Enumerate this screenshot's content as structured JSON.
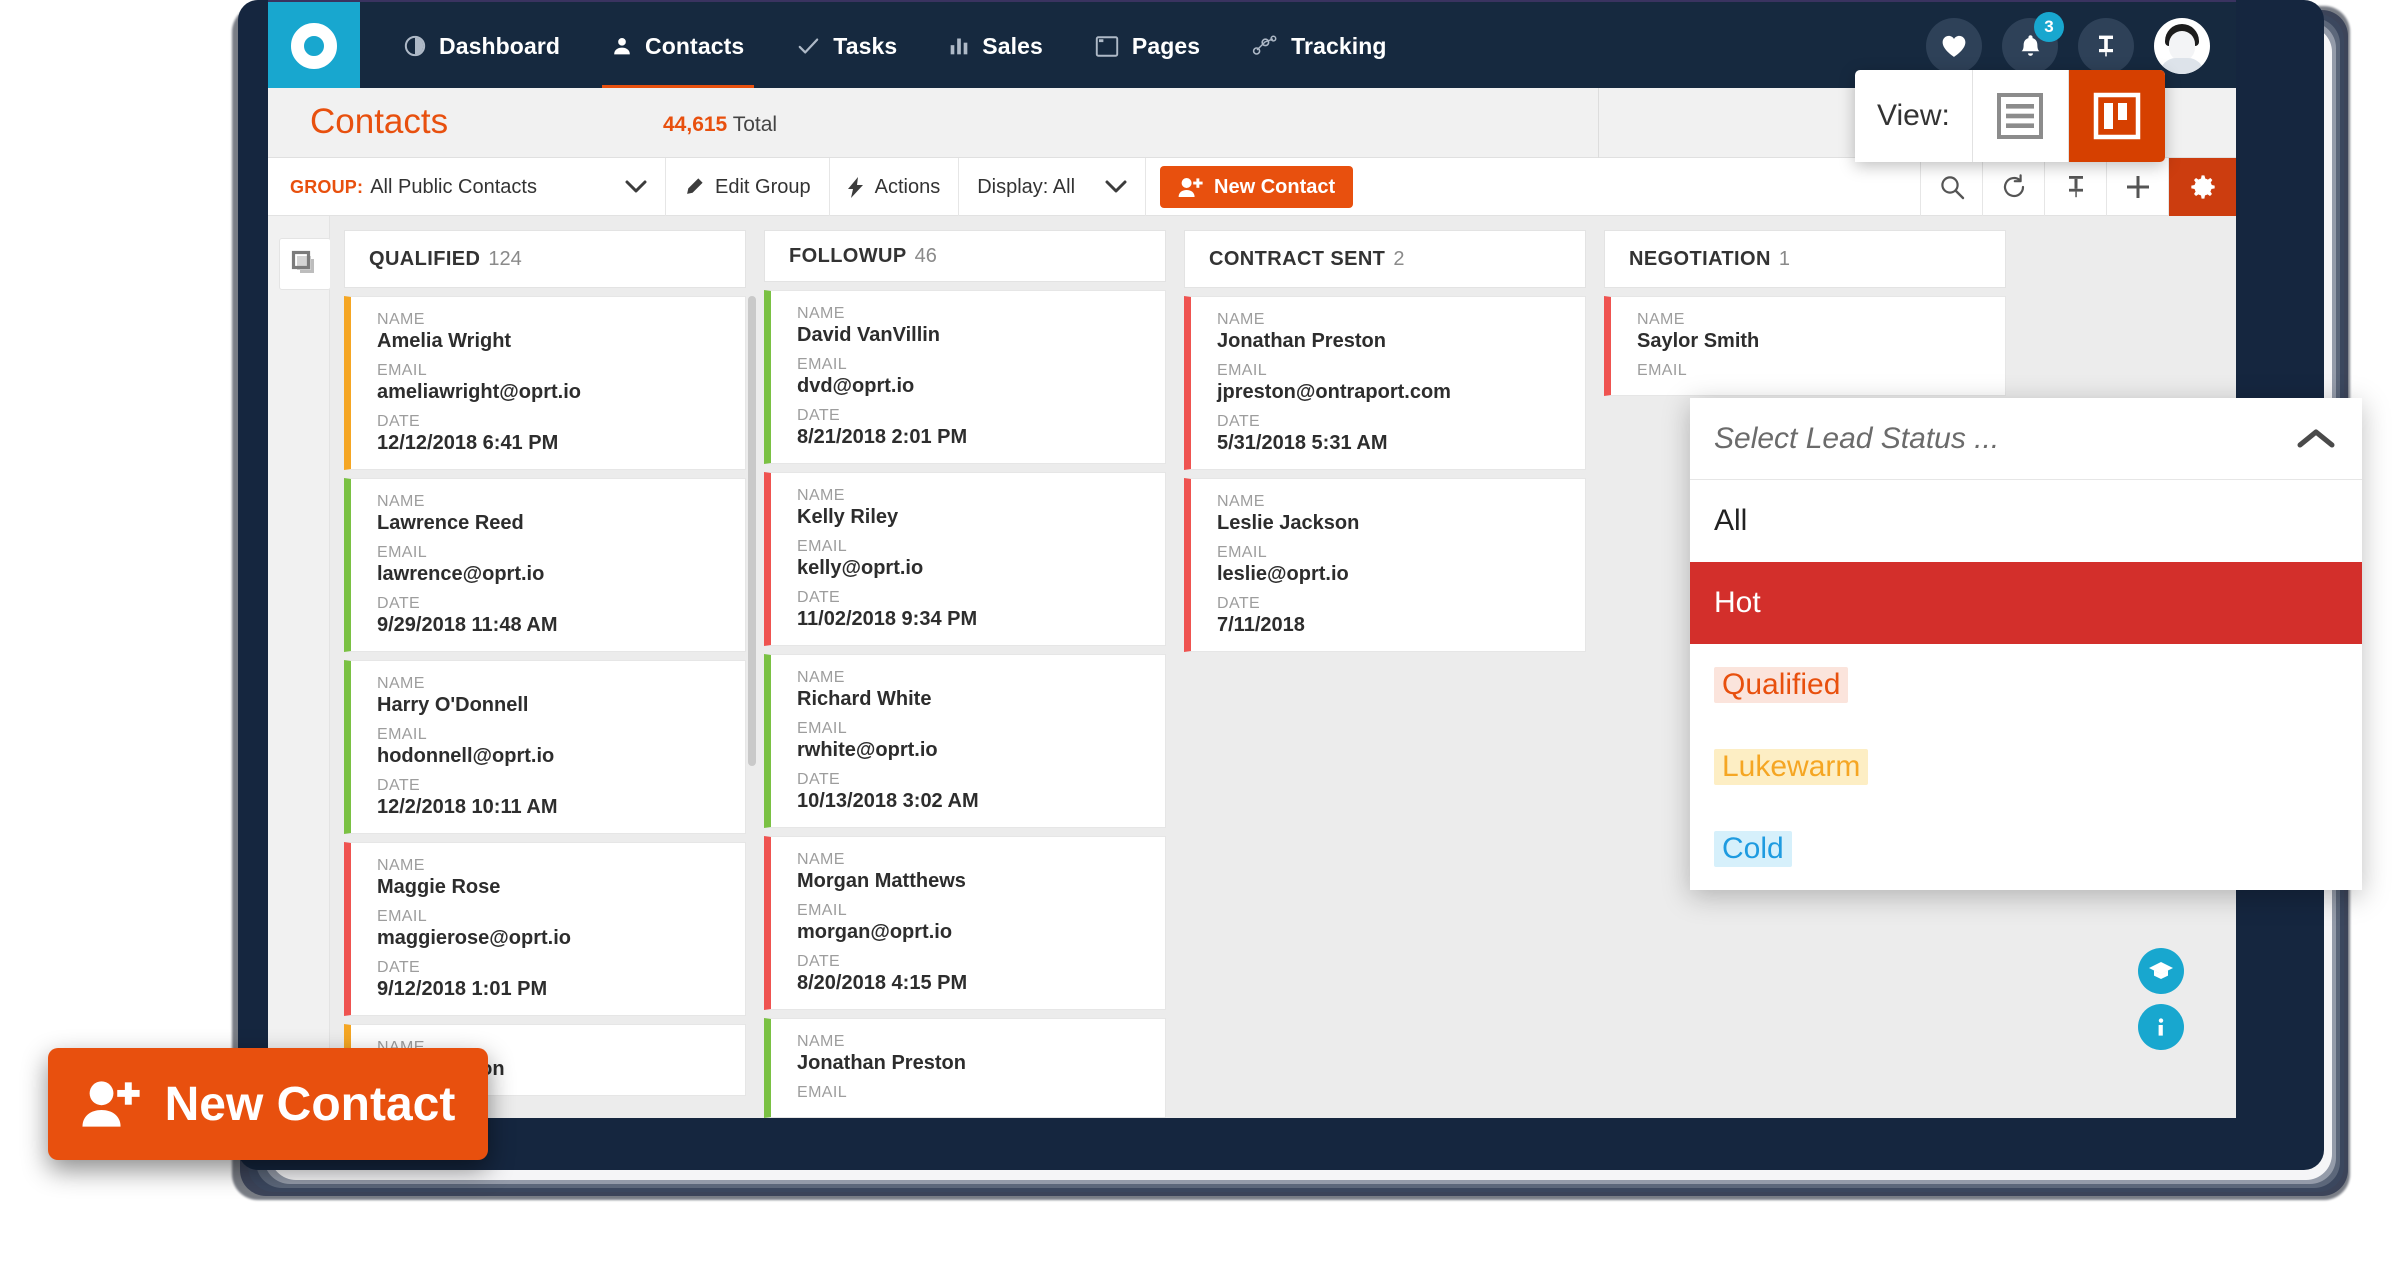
{
  "colors": {
    "brand_orange": "#e8500e",
    "nav_dark": "#16293f",
    "logo_blue": "#18a7cf",
    "hot_red": "#d32f2b",
    "qualified_orange": "#e8500e",
    "lukewarm_yellow": "#f5a623",
    "cold_blue": "#1e9be0"
  },
  "topnav": {
    "logo_name": "ontraport-logo",
    "items": [
      {
        "label": "Dashboard",
        "icon": "dashboard-icon",
        "active": false
      },
      {
        "label": "Contacts",
        "icon": "person-icon",
        "active": true
      },
      {
        "label": "Tasks",
        "icon": "check-icon",
        "active": false
      },
      {
        "label": "Sales",
        "icon": "bar-chart-icon",
        "active": false
      },
      {
        "label": "Pages",
        "icon": "window-icon",
        "active": false
      },
      {
        "label": "Tracking",
        "icon": "nodes-icon",
        "active": false
      }
    ],
    "right_icons": [
      {
        "name": "heart-icon",
        "badge": ""
      },
      {
        "name": "bell-icon",
        "badge": "3"
      },
      {
        "name": "pin-icon",
        "badge": ""
      },
      {
        "name": "avatar",
        "badge": ""
      }
    ]
  },
  "page": {
    "title": "Contacts",
    "total_value": "44,615",
    "total_label": "Total"
  },
  "toolbar": {
    "group_key": "GROUP:",
    "group_value": "All Public Contacts",
    "edit_group_label": "Edit Group",
    "actions_label": "Actions",
    "display_label": "Display: All",
    "new_contact_label": "New Contact",
    "icons": [
      {
        "name": "search-icon"
      },
      {
        "name": "refresh-icon"
      },
      {
        "name": "pin-icon"
      },
      {
        "name": "plus-icon"
      },
      {
        "name": "gear-icon"
      }
    ]
  },
  "view_toggle": {
    "label": "View:",
    "list_icon": "list-view-icon",
    "board_icon": "board-view-icon",
    "selected": "board"
  },
  "lead_status_dropdown": {
    "placeholder": "Select Lead Status ...",
    "chevron": "chevron-up-icon",
    "options": [
      {
        "label": "All",
        "style": "plain"
      },
      {
        "label": "Hot",
        "style": "selected-row"
      },
      {
        "label": "Qualified",
        "style": "pill-orange"
      },
      {
        "label": "Lukewarm",
        "style": "pill-yellow"
      },
      {
        "label": "Cold",
        "style": "pill-blue"
      }
    ]
  },
  "board": {
    "field_labels": {
      "name": "NAME",
      "email": "EMAIL",
      "date": "DATE"
    },
    "columns": [
      {
        "name": "QUALIFIED",
        "count": "124",
        "cards": [
          {
            "name": "Amelia Wright",
            "email": "ameliawright@oprt.io",
            "date": "12/12/2018 6:41 PM",
            "accent": "#f5a623"
          },
          {
            "name": "Lawrence Reed",
            "email": "lawrence@oprt.io",
            "date": "9/29/2018 11:48 AM",
            "accent": "#7ac143"
          },
          {
            "name": "Harry O'Donnell",
            "email": "hodonnell@oprt.io",
            "date": "12/2/2018 10:11 AM",
            "accent": "#7ac143"
          },
          {
            "name": "Maggie Rose",
            "email": "maggierose@oprt.io",
            "date": "9/12/2018 1:01 PM",
            "accent": "#ef5350"
          },
          {
            "name": "Sara Winston",
            "email": "",
            "date": "",
            "accent": "#f5a623"
          }
        ]
      },
      {
        "name": "FOLLOWUP",
        "count": "46",
        "cards": [
          {
            "name": "David VanVillin",
            "email": "dvd@oprt.io",
            "date": "8/21/2018 2:01 PM",
            "accent": "#7ac143"
          },
          {
            "name": "Kelly Riley",
            "email": "kelly@oprt.io",
            "date": "11/02/2018 9:34 PM",
            "accent": "#ef5350"
          },
          {
            "name": "Richard White",
            "email": "rwhite@oprt.io",
            "date": "10/13/2018 3:02 AM",
            "accent": "#7ac143"
          },
          {
            "name": "Morgan Matthews",
            "email": "morgan@oprt.io",
            "date": "8/20/2018 4:15 PM",
            "accent": "#ef5350"
          },
          {
            "name": "Jonathan Preston",
            "email": "EMAIL",
            "date": "",
            "accent": "#7ac143"
          }
        ]
      },
      {
        "name": "CONTRACT SENT",
        "count": "2",
        "cards": [
          {
            "name": "Jonathan Preston",
            "email": "jpreston@ontraport.com",
            "date": "5/31/2018 5:31 AM",
            "accent": "#ef5350"
          },
          {
            "name": "Leslie Jackson",
            "email": "leslie@oprt.io",
            "date": "7/11/2018",
            "accent": "#ef5350"
          }
        ]
      },
      {
        "name": "NEGOTIATION",
        "count": "1",
        "cards": [
          {
            "name": "Saylor Smith",
            "email": "EMAIL",
            "date": "",
            "accent": "#ef5350"
          }
        ]
      }
    ]
  },
  "helpers": [
    {
      "name": "learn-icon"
    },
    {
      "name": "info-icon"
    }
  ],
  "magnified_button": {
    "label": "New Contact",
    "icon": "add-person-icon"
  }
}
